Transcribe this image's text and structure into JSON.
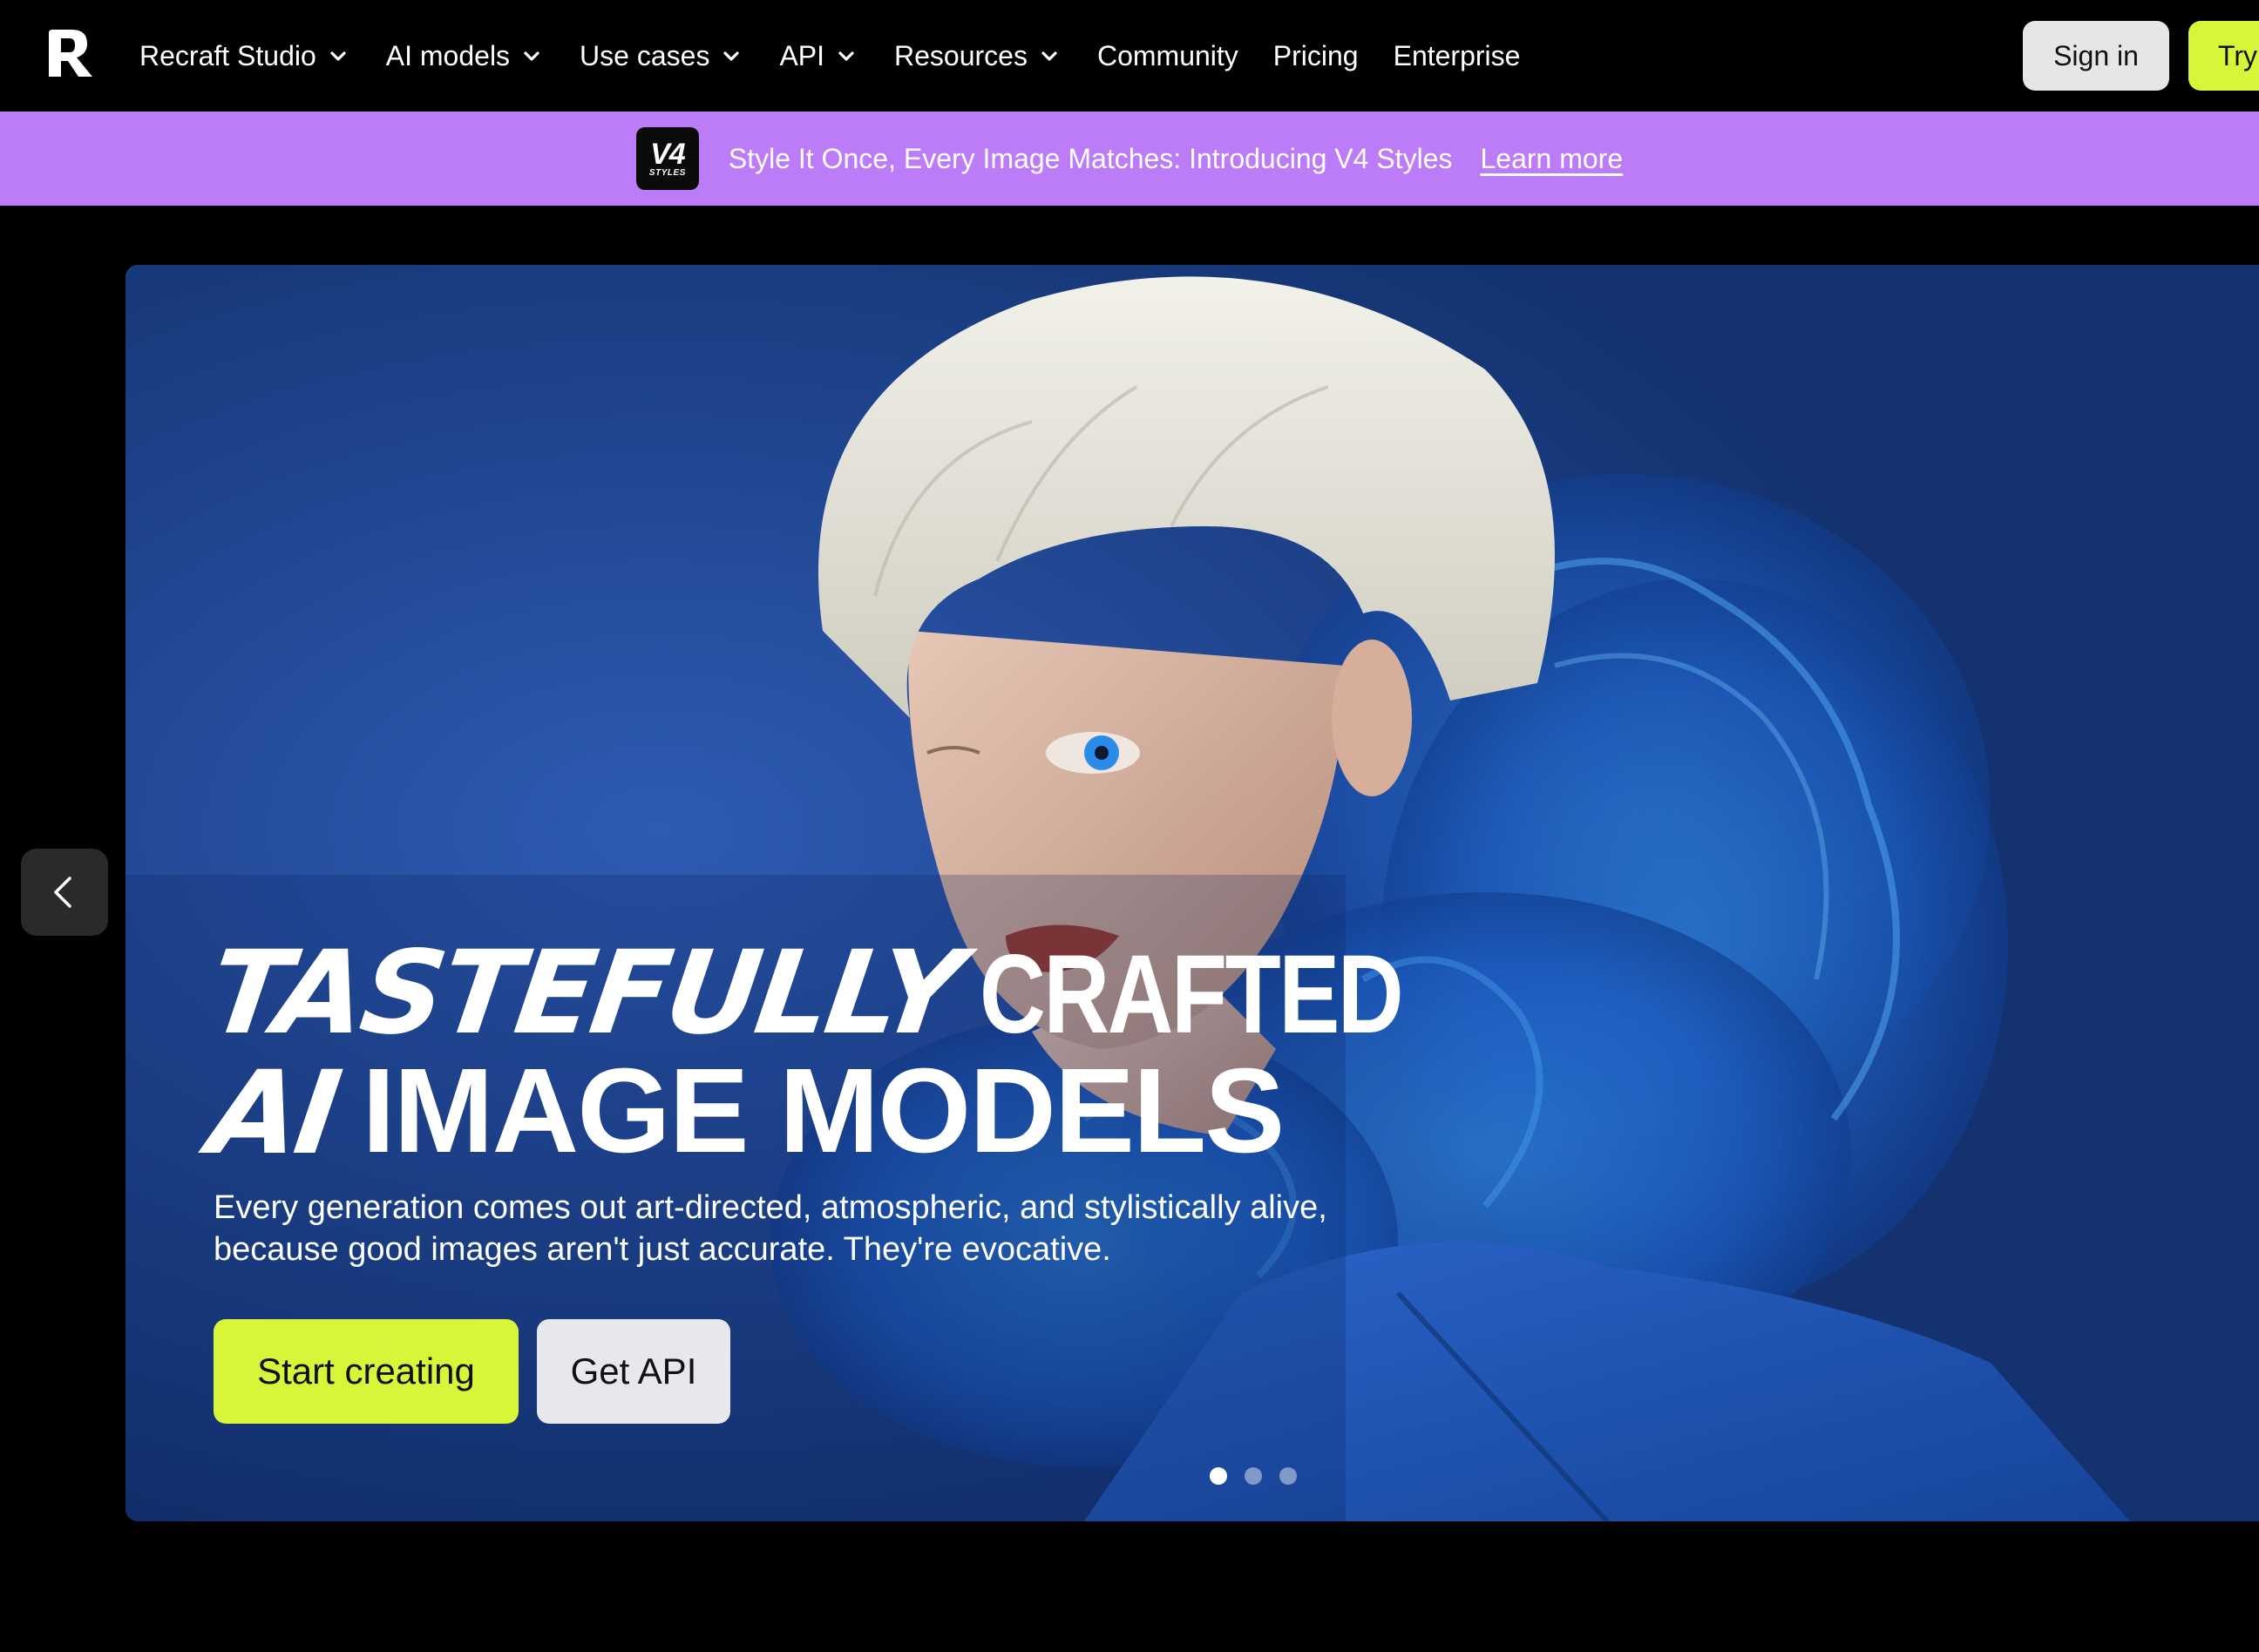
{
  "nav": {
    "logo_icon": "recraft-logo-icon",
    "items": [
      {
        "label": "Recraft Studio",
        "has_dropdown": true
      },
      {
        "label": "AI models",
        "has_dropdown": true
      },
      {
        "label": "Use cases",
        "has_dropdown": true
      },
      {
        "label": "API",
        "has_dropdown": true
      },
      {
        "label": "Resources",
        "has_dropdown": true
      },
      {
        "label": "Community",
        "has_dropdown": false
      },
      {
        "label": "Pricing",
        "has_dropdown": false
      },
      {
        "label": "Enterprise",
        "has_dropdown": false
      }
    ],
    "sign_in_label": "Sign in",
    "try_label": "Try"
  },
  "announcement": {
    "badge_main": "V4",
    "badge_sub": "STYLES",
    "text": "Style It Once, Every Image Matches: Introducing V4 Styles",
    "link_label": "Learn more",
    "background_color": "#bc7cf7"
  },
  "hero": {
    "title_line1_a": "TASTEFULLY",
    "title_line1_b": "CRAFTED",
    "title_line2_a": "AI",
    "title_line2_b": "IMAGE MODELS",
    "subtitle": "Every generation comes out art-directed, atmospheric, and stylistically alive, because good images aren't just accurate. They're evocative.",
    "primary_cta": "Start creating",
    "secondary_cta": "Get API",
    "carousel_total": 3,
    "carousel_active": 1,
    "prev_icon": "chevron-left-icon"
  },
  "colors": {
    "accent": "#d9f53a",
    "background": "#000000",
    "hero_blue": "#1f4a9e"
  }
}
